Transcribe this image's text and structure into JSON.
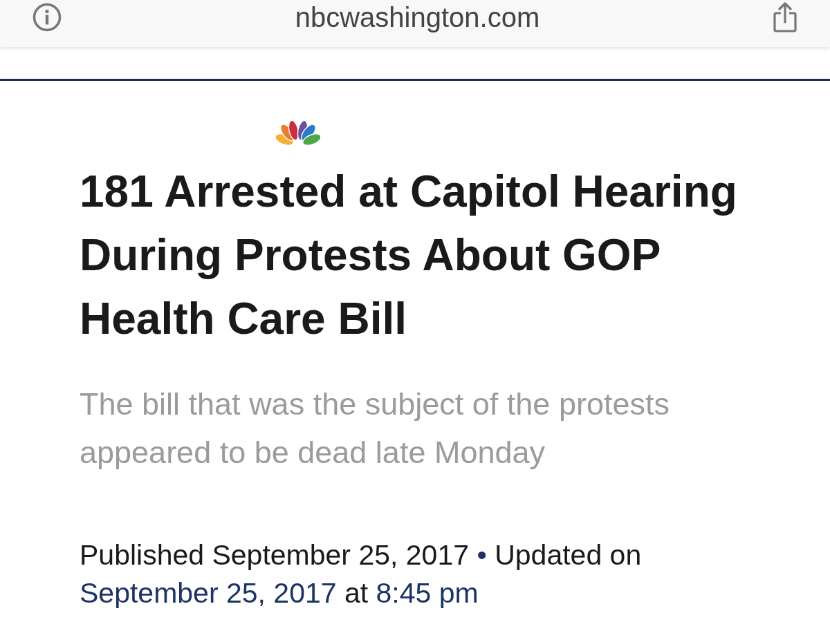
{
  "browser_bar": {
    "url": "nbcwashington.com"
  },
  "article": {
    "headline": "181 Arrested at Capitol Hearing During Protests About GOP Health Care Bill",
    "subheadline": "The bill that was the subject of the protests appeared to be dead late Monday",
    "byline": [
      {
        "kind": "plain",
        "text": "Published September 25, 2017"
      },
      {
        "kind": "separator",
        "text": "•"
      },
      {
        "kind": "plain",
        "text": "Updated on"
      },
      {
        "kind": "highlight",
        "text": "September 25, 2017"
      },
      {
        "kind": "plain",
        "text": "at"
      },
      {
        "kind": "highlight",
        "text": "8:45 pm"
      }
    ]
  }
}
